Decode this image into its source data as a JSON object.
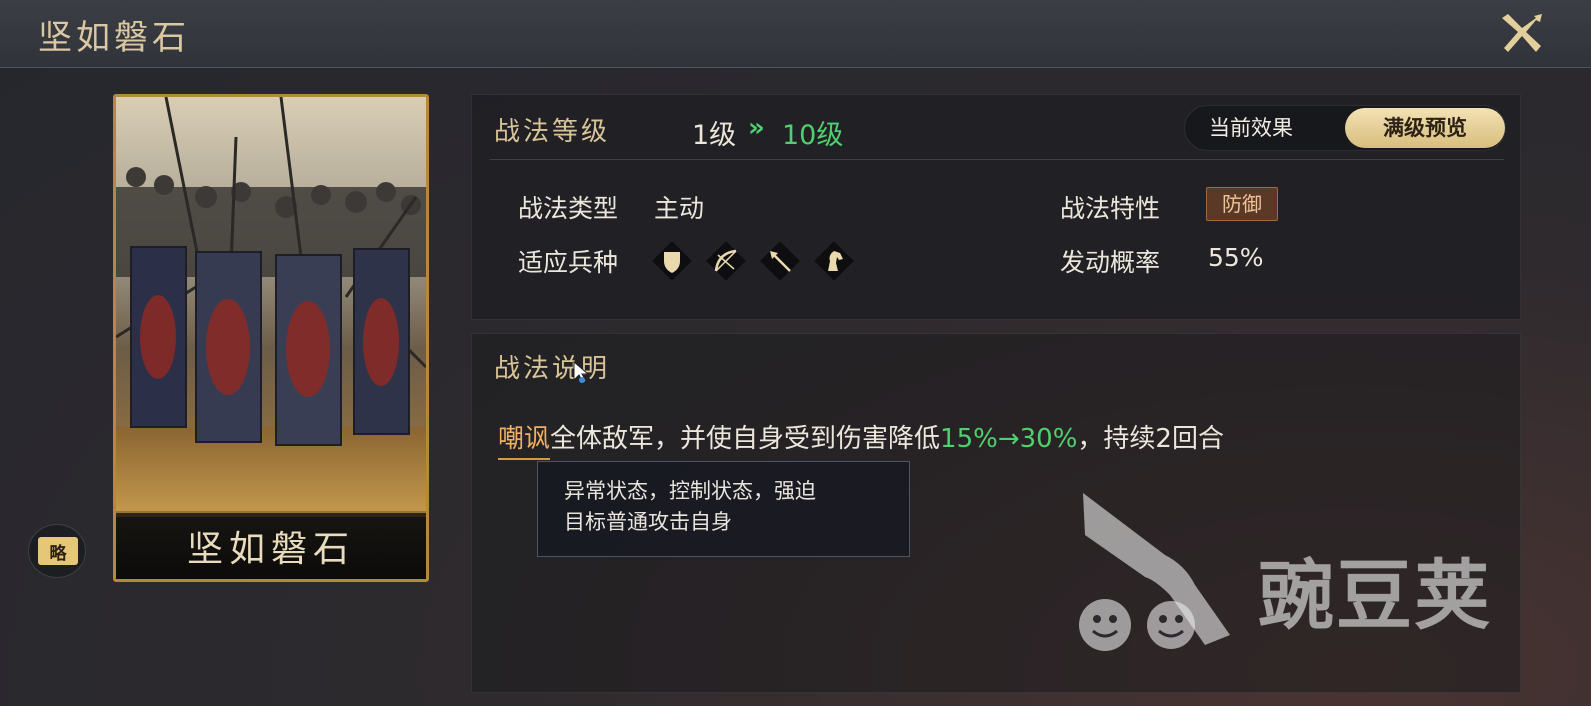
{
  "title": "坚如磐石",
  "card": {
    "name": "坚如磐石",
    "strategy_badge": "略",
    "frame_color": "#b48a3a"
  },
  "level": {
    "label": "战法等级",
    "from": "1级",
    "arrow": "»",
    "to": "10级"
  },
  "toggle": {
    "current": "当前效果",
    "max_preview": "满级预览",
    "selected": "满级预览"
  },
  "attributes": {
    "type_label": "战法类型",
    "type_value": "主动",
    "trait_label": "战法特性",
    "trait_value": "防御",
    "units_label": "适应兵种",
    "units": [
      "shield-unit-icon",
      "bow-unit-icon",
      "spear-unit-icon",
      "horse-unit-icon"
    ],
    "rate_label": "发动概率",
    "rate_value": "55%"
  },
  "description": {
    "label": "战法说明",
    "keyword": "嘲讽",
    "text_1": "全体敌军，并使自身受到伤害降低",
    "value_change": "15%→30%",
    "text_2": "，持续2回合",
    "tooltip_line1": "异常状态，控制状态，强迫",
    "tooltip_line2": "目标普通攻击自身"
  },
  "watermark": "豌豆荚",
  "colors": {
    "accent_gold": "#d8c497",
    "green_value": "#4fcf6e",
    "keyword_orange": "#f0b062"
  }
}
